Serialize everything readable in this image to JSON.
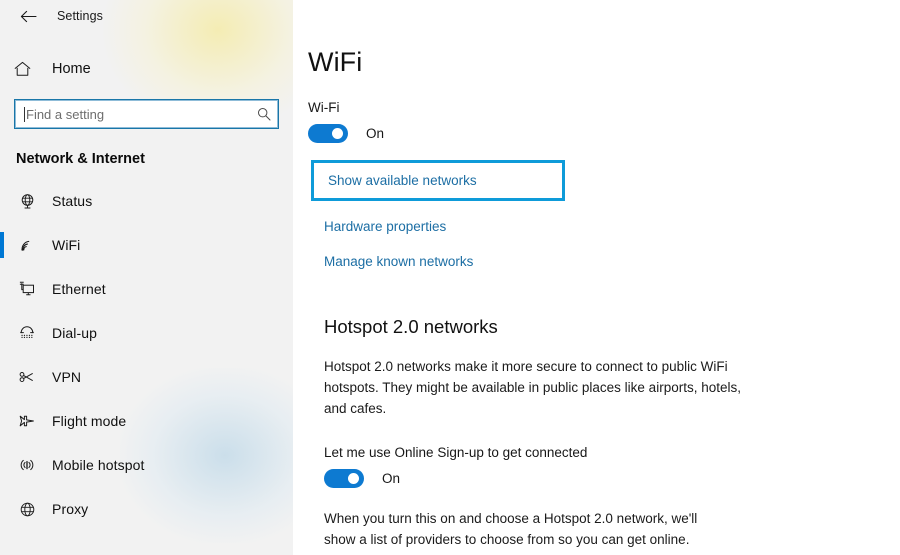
{
  "titlebar": {
    "back_icon": "back-arrow-icon",
    "title": "Settings"
  },
  "sidebar": {
    "home": {
      "label": "Home",
      "icon": "home-icon"
    },
    "search": {
      "value": "",
      "placeholder": "Find a setting",
      "icon": "search-icon"
    },
    "category_title": "Network & Internet",
    "items": [
      {
        "label": "Status",
        "icon": "status-globe-icon",
        "selected": false
      },
      {
        "label": "WiFi",
        "icon": "wifi-icon",
        "selected": true
      },
      {
        "label": "Ethernet",
        "icon": "ethernet-monitor-icon",
        "selected": false
      },
      {
        "label": "Dial-up",
        "icon": "dialup-phone-icon",
        "selected": false
      },
      {
        "label": "VPN",
        "icon": "vpn-key-icon",
        "selected": false
      },
      {
        "label": "Flight mode",
        "icon": "airplane-icon",
        "selected": false
      },
      {
        "label": "Mobile hotspot",
        "icon": "broadcast-antenna-icon",
        "selected": false
      },
      {
        "label": "Proxy",
        "icon": "globe-icon",
        "selected": false
      }
    ],
    "selected_indicator_color": "#0078d4"
  },
  "main": {
    "page_title": "WiFi",
    "wifi": {
      "label": "Wi-Fi",
      "toggle_state": "On",
      "toggle_on": true
    },
    "links": {
      "show_available_networks": "Show available networks",
      "hardware_properties": "Hardware properties",
      "manage_known_networks": "Manage known networks"
    },
    "highlight": {
      "target": "Show available networks",
      "border_color": "#0e9bd9"
    },
    "hotspot": {
      "heading": "Hotspot 2.0 networks",
      "description": "Hotspot 2.0 networks make it more secure to connect to public WiFi hotspots. They might be available in public places like airports, hotels, and cafes.",
      "signup_label": "Let me use Online Sign-up to get connected",
      "signup_toggle_state": "On",
      "signup_toggle_on": true,
      "footnote": "When you turn this on and choose a Hotspot 2.0 network, we'll show a list of providers to choose from so you can get online."
    }
  },
  "colors": {
    "accent": "#0078d4",
    "toggle": "#0d7ad1",
    "link": "#1c6ea4",
    "highlight": "#0e9bd9",
    "sidebar_bg": "#f2f2f2"
  }
}
